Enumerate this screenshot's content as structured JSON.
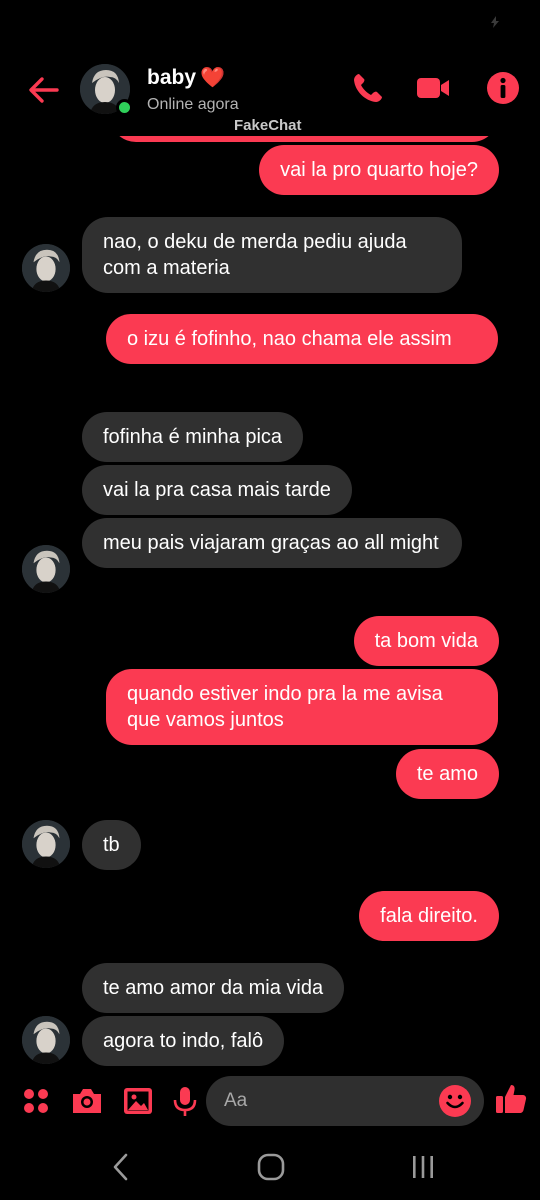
{
  "header": {
    "contact_name": "baby",
    "heart_emoji": "❤️",
    "status": "Online agora",
    "watermark": "FakeChat"
  },
  "icons": {
    "back": "arrow-left-icon",
    "call": "phone-icon",
    "video": "video-camera-icon",
    "info": "info-icon",
    "menu": "four-dots-icon",
    "camera": "camera-icon",
    "gallery": "image-icon",
    "mic": "microphone-icon",
    "emoji": "smiley-icon",
    "like": "thumbs-up-icon"
  },
  "colors": {
    "accent": "#fb3a52",
    "received_bubble": "#303030",
    "background": "#000000",
    "online": "#2fd05a"
  },
  "messages": [
    {
      "from": "me",
      "text": "vai la pro quarto hoje?"
    },
    {
      "from": "them",
      "text": "nao, o deku de merda pediu ajuda com a materia"
    },
    {
      "from": "me",
      "text": "o izu é fofinho, nao chama ele assim"
    },
    {
      "from": "them",
      "text": "fofinha é minha pica"
    },
    {
      "from": "them",
      "text": "vai la pra casa mais tarde"
    },
    {
      "from": "them",
      "text": "meu pais viajaram graças ao all might"
    },
    {
      "from": "me",
      "text": "ta bom vida"
    },
    {
      "from": "me",
      "text": "quando estiver indo pra la me avisa que vamos juntos"
    },
    {
      "from": "me",
      "text": "te amo"
    },
    {
      "from": "them",
      "text": "tb"
    },
    {
      "from": "me",
      "text": "fala direito."
    },
    {
      "from": "them",
      "text": "te amo amor da mia vida"
    },
    {
      "from": "them",
      "text": "agora to indo, falô"
    }
  ],
  "composer": {
    "placeholder": "Aa"
  }
}
